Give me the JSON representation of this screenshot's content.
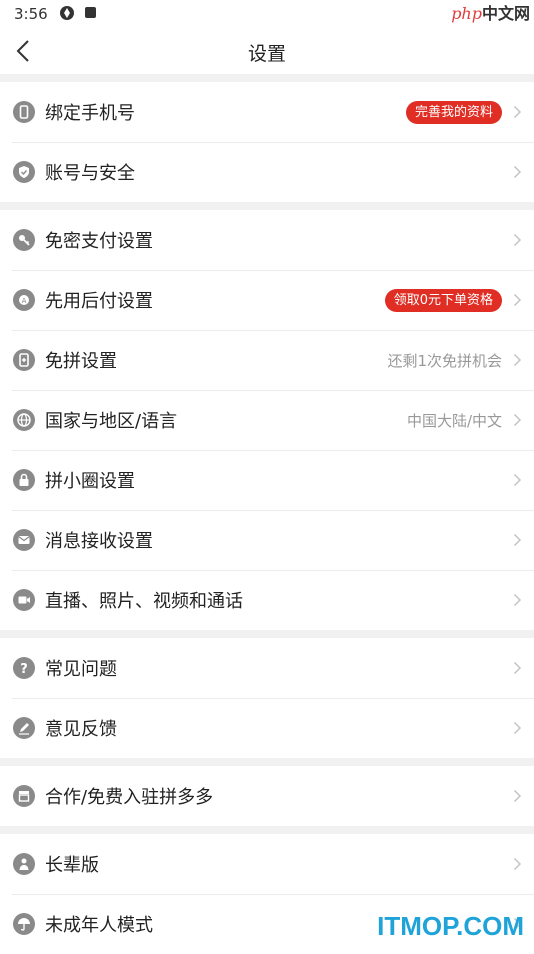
{
  "status_bar": {
    "time": "3:56"
  },
  "watermark": {
    "php": "php",
    "cn": "中文网"
  },
  "header": {
    "title": "设置"
  },
  "groups": [
    [
      {
        "label": "绑定手机号",
        "badge": "完善我的资料",
        "icon": "phone-icon"
      },
      {
        "label": "账号与安全",
        "icon": "shield-icon"
      }
    ],
    [
      {
        "label": "免密支付设置",
        "icon": "key-icon"
      },
      {
        "label": "先用后付设置",
        "badge": "领取0元下单资格",
        "icon": "badge-icon"
      },
      {
        "label": "免拼设置",
        "value": "还剩1次免拼机会",
        "icon": "card-icon"
      },
      {
        "label": "国家与地区/语言",
        "value": "中国大陆/中文",
        "icon": "globe-icon"
      },
      {
        "label": "拼小圈设置",
        "icon": "lock-icon"
      },
      {
        "label": "消息接收设置",
        "icon": "mail-icon"
      },
      {
        "label": "直播、照片、视频和通话",
        "icon": "video-icon"
      }
    ],
    [
      {
        "label": "常见问题",
        "icon": "question-icon"
      },
      {
        "label": "意见反馈",
        "icon": "edit-icon"
      }
    ],
    [
      {
        "label": "合作/免费入驻拼多多",
        "icon": "store-icon"
      }
    ],
    [
      {
        "label": "长辈版",
        "icon": "elder-icon"
      },
      {
        "label": "未成年人模式",
        "icon": "umbrella-icon"
      }
    ]
  ],
  "footer_watermark": "ITMOP.COM",
  "colors": {
    "accent": "#e02e24",
    "icon": "#8a8a8a",
    "secondary_text": "#999999",
    "divider": "#f1f1f1"
  }
}
